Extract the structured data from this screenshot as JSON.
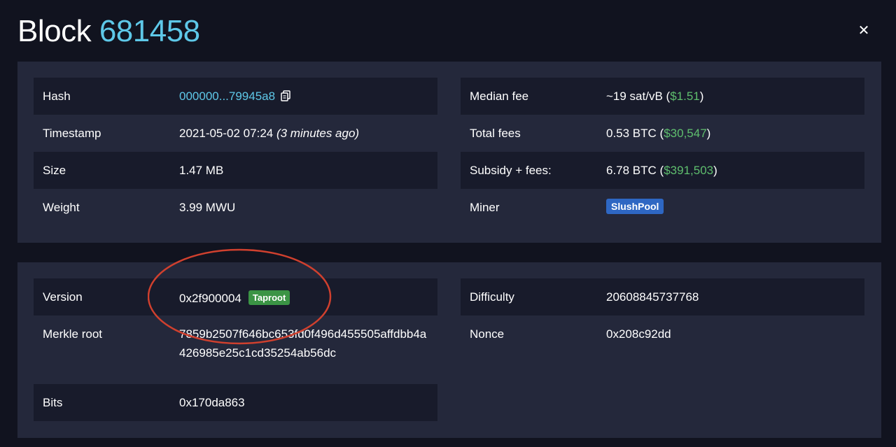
{
  "header": {
    "title_prefix": "Block",
    "block_height": "681458",
    "close_glyph": "✕"
  },
  "overview_left": {
    "rows": [
      {
        "label": "Hash",
        "value": "000000...79945a8"
      },
      {
        "label": "Timestamp",
        "value": "2021-05-02 07:24",
        "relative": "(3 minutes ago)"
      },
      {
        "label": "Size",
        "value": "1.47 MB"
      },
      {
        "label": "Weight",
        "value": "3.99 MWU"
      }
    ]
  },
  "overview_right": {
    "rows": [
      {
        "label": "Median fee",
        "value": "~19 sat/vB",
        "fiat": "$1.51"
      },
      {
        "label": "Total fees",
        "value": "0.53 BTC",
        "fiat": "$30,547"
      },
      {
        "label": "Subsidy + fees:",
        "value": "6.78 BTC",
        "fiat": "$391,503"
      },
      {
        "label": "Miner",
        "badge": "SlushPool"
      }
    ]
  },
  "details_left": {
    "rows": [
      {
        "label": "Version",
        "value": "0x2f900004",
        "badge": "Taproot"
      },
      {
        "label": "Merkle root",
        "value": "7859b2507f646bc653fd0f496d455505affdbb4a426985e25c1cd35254ab56dc"
      },
      {
        "label": "Bits",
        "value": "0x170da863"
      }
    ]
  },
  "details_right": {
    "rows": [
      {
        "label": "Difficulty",
        "value": "20608845737768"
      },
      {
        "label": "Nonce",
        "value": "0x208c92dd"
      }
    ]
  },
  "colors": {
    "background": "#11131f",
    "panel": "#24283b",
    "stripe": "#181b2b",
    "accent_link": "#5ec8e8",
    "fiat_green": "#5fbf6e",
    "taproot_badge": "#3b9445",
    "pool_badge": "#2e67c3",
    "annotation_circle": "#d0402e"
  }
}
